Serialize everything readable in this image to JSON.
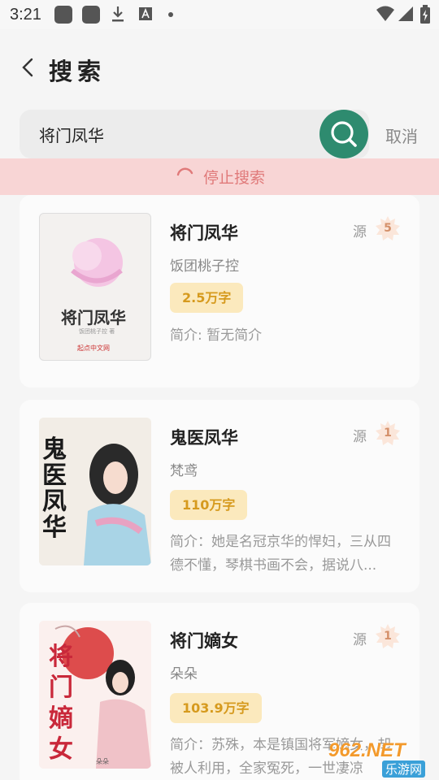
{
  "status_bar": {
    "time": "3:21"
  },
  "header": {
    "title": "搜索"
  },
  "search": {
    "value": "将门凤华",
    "cancel_label": "取消"
  },
  "stop_bar": {
    "label": "停止搜索"
  },
  "results": [
    {
      "title": "将门凤华",
      "author": "饭团桃子控",
      "words": "2.5万字",
      "intro": "简介: 暂无简介",
      "source_label": "源",
      "source_count": "5",
      "cover_title": "将门凤华",
      "cover_author": "饭团桃子控 著",
      "cover_publisher": "起点中文网"
    },
    {
      "title": "鬼医凤华",
      "author": "梵鸢",
      "words": "110万字",
      "intro": "简介：她是名冠京华的悍妇，三从四德不懂，琴棋书画不会，据说八...",
      "source_label": "源",
      "source_count": "1",
      "cover_title": "鬼医凤华"
    },
    {
      "title": "将门嫡女",
      "author": "朵朵",
      "words": "103.9万字",
      "intro": "简介：苏殊，本是镇国将军嫡女，却被人利用，全家冤死，一世凄凉",
      "source_label": "源",
      "source_count": "1",
      "cover_title": "将门嫡女",
      "cover_author": "朵朵"
    }
  ],
  "watermark": {
    "brand": "962.NET",
    "sub": "乐游网"
  },
  "colors": {
    "accent": "#2e8b6f",
    "stop_bg": "#f8d5d5",
    "stop_text": "#e07a7a",
    "badge_bg": "#fbe9bd",
    "badge_text": "#d69a1e"
  }
}
